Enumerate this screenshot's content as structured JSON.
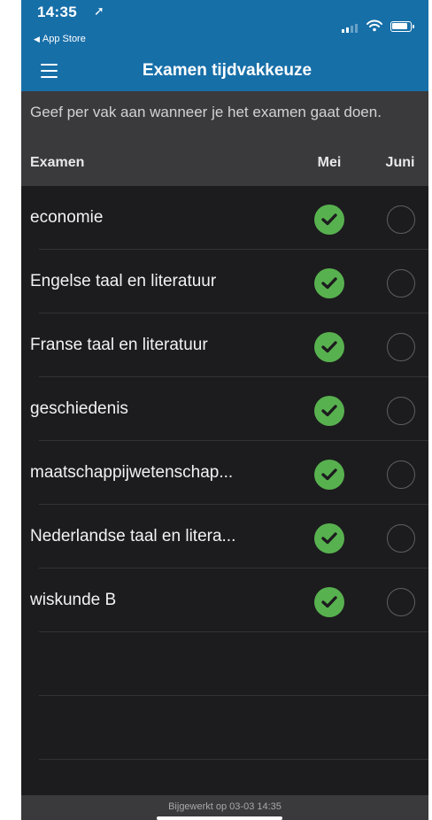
{
  "status_bar": {
    "time": "14:35",
    "back_app": "App Store",
    "location_icon": "location-arrow-icon",
    "signal_icon": "cellular-signal-icon",
    "wifi_icon": "wifi-icon",
    "battery_icon": "battery-icon"
  },
  "nav": {
    "title": "Examen tijdvakkeuze",
    "menu_icon": "hamburger-menu-icon"
  },
  "instruction": "Geef per vak aan wanneer je het examen gaat doen.",
  "table": {
    "headers": {
      "exam": "Examen",
      "mei": "Mei",
      "juni": "Juni"
    },
    "rows": [
      {
        "name": "economie",
        "selected": "Mei"
      },
      {
        "name": "Engelse taal en literatuur",
        "selected": "Mei"
      },
      {
        "name": "Franse taal en literatuur",
        "selected": "Mei"
      },
      {
        "name": "geschiedenis",
        "selected": "Mei"
      },
      {
        "name": "maatschappijwetenschap...",
        "selected": "Mei"
      },
      {
        "name": "Nederlandse taal en litera...",
        "selected": "Mei"
      },
      {
        "name": "wiskunde B",
        "selected": "Mei"
      }
    ]
  },
  "footer": "Bijgewerkt op 03-03 14:35",
  "colors": {
    "nav_bg": "#176fa8",
    "selected_green": "#58b14f",
    "list_bg": "#1c1c1e",
    "header_bg": "#3a3a3c"
  }
}
